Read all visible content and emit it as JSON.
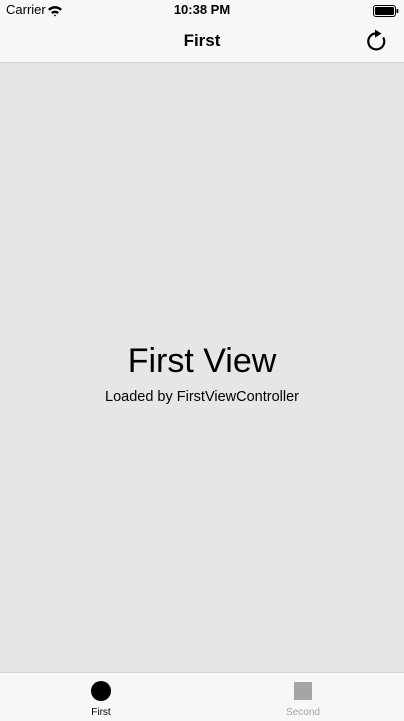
{
  "status_bar": {
    "carrier": "Carrier",
    "time": "10:38 PM",
    "icons": [
      "wifi-icon",
      "battery-icon"
    ]
  },
  "nav_bar": {
    "title": "First",
    "right_button_icon": "refresh-icon"
  },
  "main": {
    "title": "First View",
    "subtitle": "Loaded by FirstViewController",
    "background_color": "#e6e6e8"
  },
  "tab_bar": {
    "tabs": [
      {
        "label": "First",
        "icon": "circle-icon",
        "selected": true
      },
      {
        "label": "Second",
        "icon": "square-icon",
        "selected": false
      }
    ],
    "selected_color": "#000000",
    "unselected_color": "#a5a5a5"
  }
}
